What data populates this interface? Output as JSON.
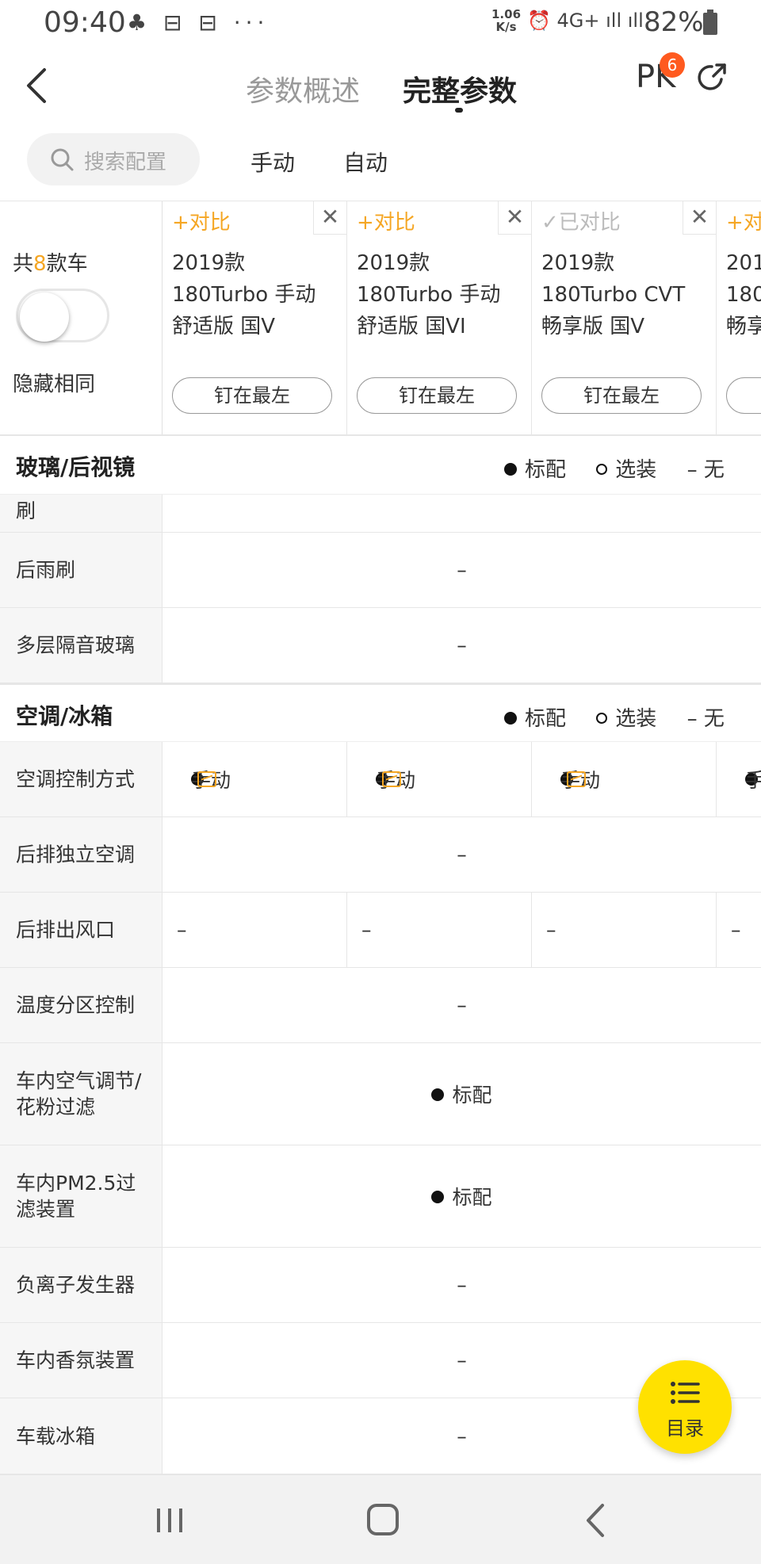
{
  "status_bar": {
    "time": "09:40",
    "icons_left": "♣ ⊟ ⊟ ···",
    "net_speed_line1": "1.06",
    "net_speed_line2": "K/s",
    "icons_right": "⏰ 4G+ ıll ıll",
    "battery": "82%"
  },
  "header": {
    "tab_overview": "参数概述",
    "tab_full": "完整参数",
    "pk_label": "PK",
    "pk_badge": "6"
  },
  "filter": {
    "search_placeholder": "搜索配置",
    "option_manual": "手动",
    "option_auto": "自动"
  },
  "car_header": {
    "count_prefix": "共",
    "count_num": "8",
    "count_suffix": "款车",
    "hide_same_label": "隐藏相同",
    "hide_same_on": false,
    "cars": [
      {
        "compare": "+对比",
        "compared": false,
        "name": "2019款\n180Turbo 手动\n舒适版 国V",
        "pin": "钉在最左"
      },
      {
        "compare": "+对比",
        "compared": false,
        "name": "2019款\n180Turbo 手动\n舒适版 国VI",
        "pin": "钉在最左"
      },
      {
        "compare": "✓已对比",
        "compared": true,
        "name": "2019款\n180Turbo CVT\n畅享版 国V",
        "pin": "钉在最左"
      },
      {
        "compare": "+对",
        "compared": false,
        "name": "201\n180\n畅享",
        "pin": ""
      }
    ],
    "close_symbol": "✕"
  },
  "legend": {
    "standard": "标配",
    "optional": "选装",
    "none": "– 无"
  },
  "sections": {
    "glass": {
      "title": "玻璃/后视镜",
      "partial_label": "刷",
      "rows": [
        {
          "label": "后雨刷",
          "value": "–"
        },
        {
          "label": "多层隔音玻璃",
          "value": "–"
        }
      ]
    },
    "ac": {
      "title": "空调/冰箱",
      "row_ac_control": {
        "label": "空调控制方式",
        "cells": [
          "手动",
          "手动",
          "手动",
          "手"
        ]
      },
      "row_rear_ac": {
        "label": "后排独立空调",
        "value": "–"
      },
      "row_rear_vent": {
        "label": "后排出风口",
        "cells": [
          "–",
          "–",
          "–",
          "–"
        ]
      },
      "row_zone": {
        "label": "温度分区控制",
        "value": "–"
      },
      "row_air_filter": {
        "label": "车内空气调节/花粉过滤",
        "value": "标配"
      },
      "row_pm25": {
        "label": "车内PM2.5过滤装置",
        "value": "标配"
      },
      "row_ion": {
        "label": "负离子发生器",
        "value": "–"
      },
      "row_fragrance": {
        "label": "车内香氛装置",
        "value": "–"
      },
      "row_fridge": {
        "label": "车载冰箱",
        "value": "–"
      }
    }
  },
  "fab": {
    "label": "目录"
  },
  "colors": {
    "accent": "#f5a623",
    "badge": "#ff5a1f",
    "fab": "#ffe100"
  }
}
